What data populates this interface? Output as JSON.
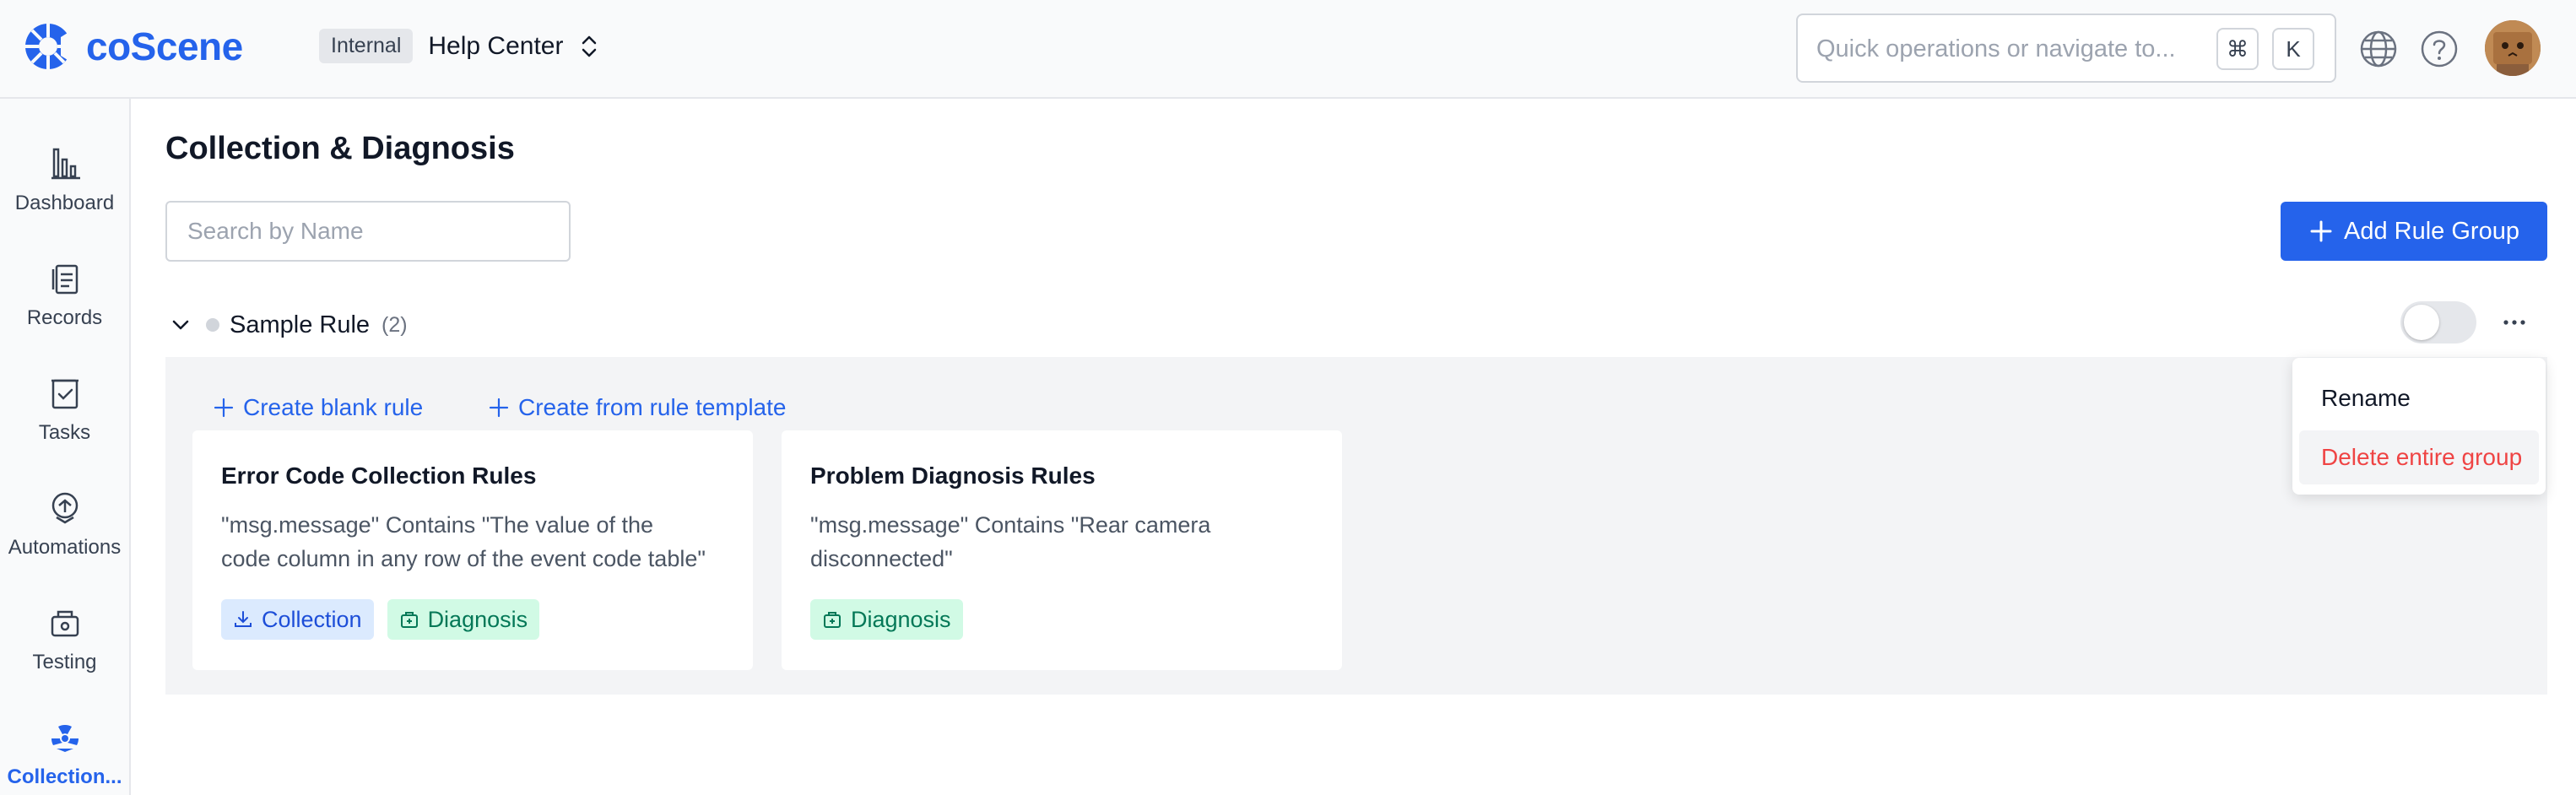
{
  "topbar": {
    "brand": "coScene",
    "project_tag": "Internal",
    "project_name": "Help Center",
    "quick_search_placeholder": "Quick operations or navigate to...",
    "kbd_cmd": "⌘",
    "kbd_k": "K"
  },
  "sidebar": {
    "items": [
      {
        "label": "Dashboard",
        "icon": "bar-chart-icon"
      },
      {
        "label": "Records",
        "icon": "records-icon"
      },
      {
        "label": "Tasks",
        "icon": "tasks-icon"
      },
      {
        "label": "Automations",
        "icon": "automation-icon"
      },
      {
        "label": "Testing",
        "icon": "testing-icon"
      },
      {
        "label": "Collection...",
        "icon": "collection-icon",
        "active": true
      }
    ]
  },
  "main": {
    "title": "Collection & Diagnosis",
    "search_placeholder": "Search by Name",
    "add_button": "Add Rule Group",
    "group": {
      "name": "Sample Rule",
      "count": "(2)",
      "enabled": false,
      "create_blank": "Create blank rule",
      "create_template": "Create from rule template",
      "rules": [
        {
          "title": "Error Code Collection Rules",
          "desc_line1": "\"msg.message\" Contains \"The value of the",
          "desc_line2": "code column in any row of the event code table\"",
          "tags": [
            "Collection",
            "Diagnosis"
          ]
        },
        {
          "title": "Problem Diagnosis Rules",
          "desc_line1": "\"msg.message\" Contains \"Rear camera",
          "desc_line2": "disconnected\"",
          "tags": [
            "Diagnosis"
          ]
        }
      ]
    },
    "menu": {
      "rename": "Rename",
      "delete": "Delete entire group"
    }
  },
  "colors": {
    "accent": "#2563eb",
    "danger": "#ef4444",
    "collection_tag_bg": "#dbeafe",
    "diagnosis_tag_bg": "#d1fae5"
  }
}
